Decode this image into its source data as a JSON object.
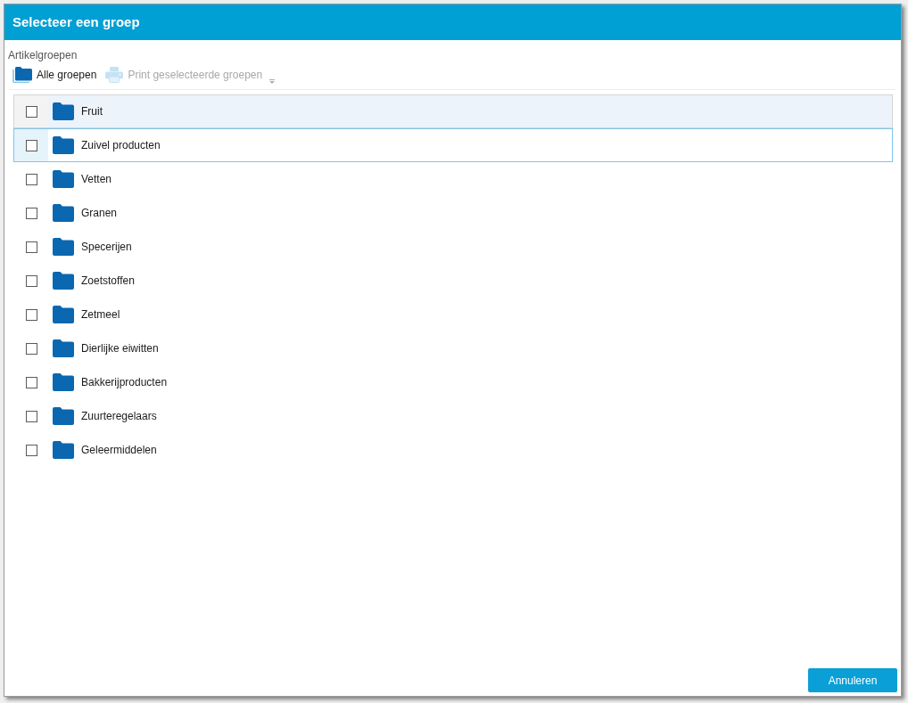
{
  "dialog": {
    "title": "Selecteer een groep"
  },
  "section_label": "Artikelgroepen",
  "toolbar": [
    {
      "label": "Alle groepen",
      "kind": "folders",
      "disabled": false
    },
    {
      "label": "Print geselecteerde groepen",
      "kind": "print",
      "disabled": true
    }
  ],
  "groups": [
    {
      "name": "Fruit",
      "checked": false,
      "selected": true,
      "focused": false
    },
    {
      "name": "Zuivel producten",
      "checked": false,
      "selected": false,
      "focused": true
    },
    {
      "name": "Vetten",
      "checked": false,
      "selected": false,
      "focused": false
    },
    {
      "name": "Granen",
      "checked": false,
      "selected": false,
      "focused": false
    },
    {
      "name": "Specerijen",
      "checked": false,
      "selected": false,
      "focused": false
    },
    {
      "name": "Zoetstoffen",
      "checked": false,
      "selected": false,
      "focused": false
    },
    {
      "name": "Zetmeel",
      "checked": false,
      "selected": false,
      "focused": false
    },
    {
      "name": "Dierlijke eiwitten",
      "checked": false,
      "selected": false,
      "focused": false
    },
    {
      "name": "Bakkerijproducten",
      "checked": false,
      "selected": false,
      "focused": false
    },
    {
      "name": "Zuurteregelaars",
      "checked": false,
      "selected": false,
      "focused": false
    },
    {
      "name": "Geleermiddelen",
      "checked": false,
      "selected": false,
      "focused": false
    }
  ],
  "buttons": [
    {
      "label": "Annuleren"
    }
  ]
}
